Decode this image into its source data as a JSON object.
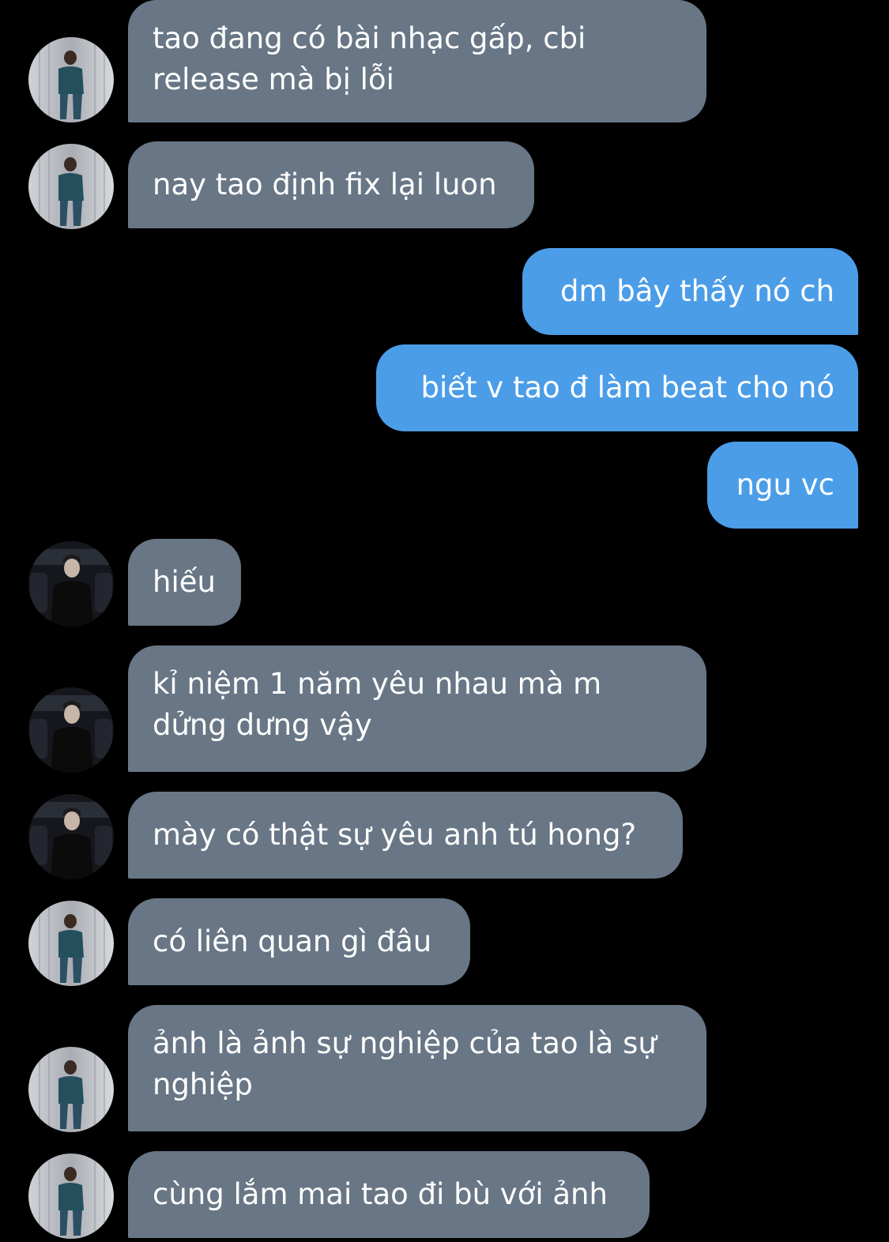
{
  "messages": [
    {
      "side": "in",
      "avatar": "avatar-a",
      "text": "tao đang có bài nhạc gấp, cbi\nrelease mà bị lỗi"
    },
    {
      "side": "in",
      "avatar": "avatar-a",
      "text": "nay tao định fix lại luon"
    },
    {
      "side": "out",
      "text": "dm bây thấy nó ch"
    },
    {
      "side": "out",
      "text": "biết v tao đ làm beat cho nó"
    },
    {
      "side": "out",
      "text": "ngu vc"
    },
    {
      "side": "in",
      "avatar": "avatar-b",
      "text": "hiếu"
    },
    {
      "side": "in",
      "avatar": "avatar-b",
      "text": "kỉ niệm 1 năm yêu nhau mà m\ndửng dưng vậy"
    },
    {
      "side": "in",
      "avatar": "avatar-b",
      "text": "mày có thật sự yêu anh tú hong?"
    },
    {
      "side": "in",
      "avatar": "avatar-a",
      "text": "có liên quan gì đâu"
    },
    {
      "side": "in",
      "avatar": "avatar-a",
      "text": "ảnh là ảnh sự nghiệp của tao là sự\nnghiệp"
    },
    {
      "side": "in",
      "avatar": "avatar-a",
      "text": "cùng lắm mai tao đi bù với ảnh"
    }
  ],
  "colors": {
    "background": "#000000",
    "incoming_bubble": "#687685",
    "outgoing_bubble": "#4b9de8",
    "text": "#ffffff"
  }
}
